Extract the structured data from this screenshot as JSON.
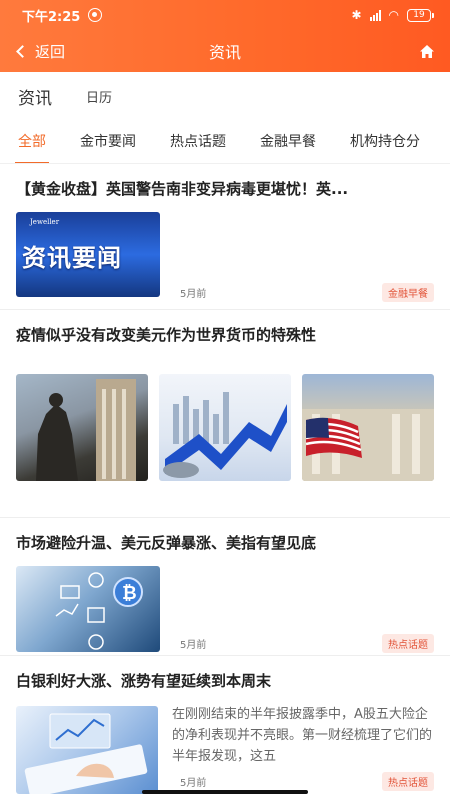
{
  "status_bar": {
    "time": "下午2:25",
    "battery": "19"
  },
  "nav": {
    "back_label": "返回",
    "title": "资讯"
  },
  "section_tabs": [
    {
      "label": "资讯",
      "active": true
    },
    {
      "label": "日历",
      "active": false
    }
  ],
  "category_tabs": [
    {
      "label": "全部",
      "active": true
    },
    {
      "label": "金市要闻",
      "active": false
    },
    {
      "label": "热点话题",
      "active": false
    },
    {
      "label": "金融早餐",
      "active": false
    },
    {
      "label": "机构持仓分",
      "active": false
    }
  ],
  "articles": [
    {
      "title": "【黄金收盘】英国警告南非变异病毒更堪忧！英...",
      "image_logo": "Jeweller",
      "image_caption": "资讯要闻",
      "time": "5月前",
      "badge": "金融早餐"
    },
    {
      "title": "疫情似乎没有改变美元作为世界货币的特殊性"
    },
    {
      "title": "市场避险升温、美元反弹暴涨、美指有望见底",
      "time": "5月前",
      "badge": "热点话题"
    },
    {
      "title": "白银利好大涨、涨势有望延续到本周末",
      "summary": "在刚刚结束的半年报披露季中，A股五大险企的净利表现并不亮眼。第一财经梳理了它们的半年报发现，这五",
      "time": "5月前",
      "badge": "热点话题"
    }
  ],
  "colors": {
    "accent": "#f26b2a",
    "header_start": "#ff7a3d",
    "header_end": "#ff5a22",
    "badge_bg": "#fde8e3",
    "badge_text": "#e2553a"
  }
}
